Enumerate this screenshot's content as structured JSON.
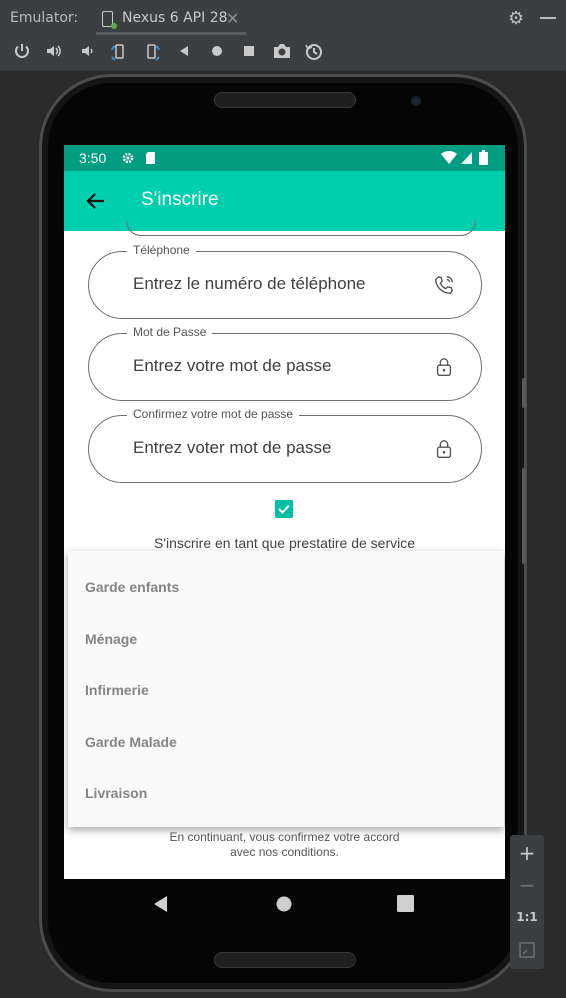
{
  "emulator": {
    "label": "Emulator:",
    "tab_title": "Nexus 6 API 28",
    "tab_close": "✕",
    "settings_icon": "gear-icon",
    "toolbar_icons": [
      "power-icon",
      "volume-up-icon",
      "volume-down-icon",
      "rotate-left-icon",
      "rotate-right-icon",
      "back-icon",
      "home-icon",
      "overview-icon",
      "camera-icon",
      "snapshot-icon"
    ],
    "zoom": {
      "plus": "+",
      "minus": "−",
      "one_to_one": "1:1"
    }
  },
  "device": {
    "status_bar": {
      "time": "3:50",
      "color": "#009d82"
    },
    "app_bar": {
      "title": "S'inscrire",
      "color": "#00cfae"
    },
    "form": {
      "fields": [
        {
          "legend": "Téléphone",
          "placeholder": "Entrez le numéro de téléphone",
          "icon": "phone-icon"
        },
        {
          "legend": "Mot de Passe",
          "placeholder": "Entrez votre mot de passe",
          "icon": "lock-icon"
        },
        {
          "legend": "Confirmez votre mot de passe",
          "placeholder": "Entrez voter mot de passe",
          "icon": "lock-icon"
        }
      ],
      "provider_checkbox": {
        "checked": true,
        "label": "S'inscrire en tant que prestatire de service",
        "color": "#00bfa5"
      }
    },
    "dropdown_menu": {
      "items": [
        "Garde enfants",
        "Ménage",
        "Infirmerie",
        "Garde Malade",
        "Livraison"
      ]
    },
    "footnote": {
      "line1": "En continuant, vous confirmez votre accord",
      "line2": "avec nos conditions."
    }
  }
}
